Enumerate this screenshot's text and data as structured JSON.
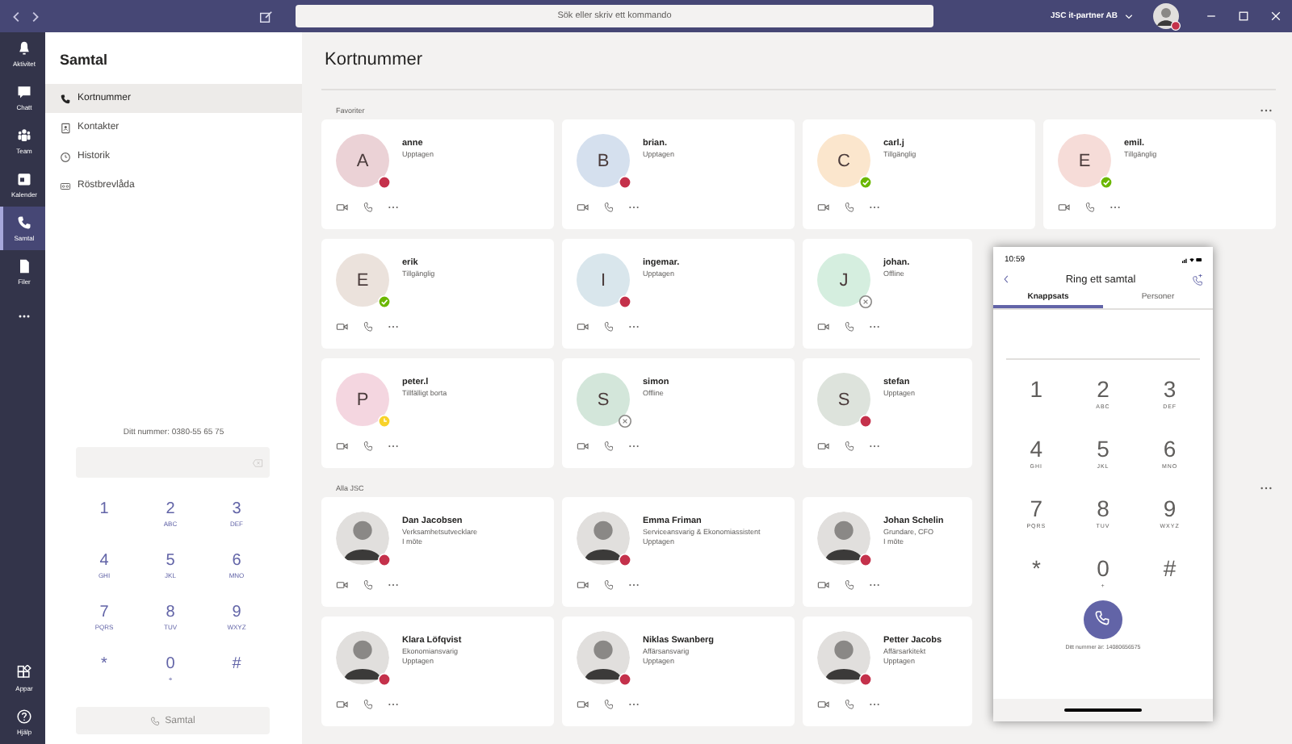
{
  "title_bar": {
    "search": {
      "placeholder": "Sök eller skriv ett kommando"
    },
    "org": "JSC it-partner AB",
    "user": {
      "presence": {
        "kind": "busy"
      }
    }
  },
  "rail": {
    "items": [
      {
        "label": "Aktivitet",
        "kind": "bell",
        "selected": false
      },
      {
        "label": "Chatt",
        "kind": "chat",
        "selected": false
      },
      {
        "label": "Team",
        "kind": "team",
        "selected": false
      },
      {
        "label": "Kalender",
        "kind": "calendar",
        "selected": false
      },
      {
        "label": "Samtal",
        "kind": "phone",
        "selected": true
      },
      {
        "label": "Filer",
        "kind": "file",
        "selected": false
      },
      {
        "kind": "more",
        "selected": false
      }
    ],
    "bottom_items": [
      {
        "label": "Appar",
        "kind": "apps"
      },
      {
        "label": "Hjälp",
        "kind": "help"
      }
    ]
  },
  "sidebar": {
    "title": "Samtal",
    "items": [
      {
        "label": "Kortnummer",
        "kind": "phone",
        "selected": true
      },
      {
        "label": "Kontakter",
        "kind": "contacts",
        "selected": false
      },
      {
        "label": "Historik",
        "kind": "clock",
        "selected": false
      },
      {
        "label": "Röstbrevlåda",
        "kind": "voicemail",
        "selected": false
      }
    ],
    "dialpad": {
      "your_number": "Ditt nummer: 0380-55 65 75",
      "keys": [
        {
          "digit": "1"
        },
        {
          "digit": "2",
          "letters": "ABC"
        },
        {
          "digit": "3",
          "letters": "DEF"
        },
        {
          "digit": "4",
          "letters": "GHI"
        },
        {
          "digit": "5",
          "letters": "JKL"
        },
        {
          "digit": "6",
          "letters": "MNO"
        },
        {
          "digit": "7",
          "letters": "PQRS"
        },
        {
          "digit": "8",
          "letters": "TUV"
        },
        {
          "digit": "9",
          "letters": "WXYZ"
        },
        {
          "digit": "*"
        },
        {
          "digit": "0",
          "letters": "+"
        },
        {
          "digit": "#"
        }
      ],
      "call_button": {
        "label": "Samtal",
        "disabled": true
      }
    }
  },
  "main": {
    "title": "Kortnummer",
    "sections": [
      {
        "label": "Favoriter",
        "contacts": [
          {
            "initial": "A",
            "color": "#ebd2d6",
            "name": "anne",
            "status": "Upptagen",
            "presence": {
              "kind": "busy"
            }
          },
          {
            "initial": "B",
            "color": "#d5e0ee",
            "name": "brian.",
            "status": "Upptagen",
            "presence": {
              "kind": "busy"
            }
          },
          {
            "initial": "C",
            "color": "#fbe6cd",
            "name": "carl.j",
            "status": "Tillgänglig",
            "presence": {
              "kind": "available"
            }
          },
          {
            "initial": "E",
            "color": "#f6dcd8",
            "name": "emil.",
            "status": "Tillgänglig",
            "presence": {
              "kind": "available"
            }
          },
          {
            "initial": "E",
            "color": "#ebe2dc",
            "name": "erik",
            "status": "Tillgänglig",
            "presence": {
              "kind": "available"
            }
          },
          {
            "initial": "I",
            "color": "#d9e6ec",
            "name": "ingemar.",
            "status": "Upptagen",
            "presence": {
              "kind": "busy"
            }
          },
          {
            "initial": "J",
            "color": "#d5eedf",
            "name": "johan.",
            "status": "Offline",
            "presence": {
              "kind": "offline"
            }
          },
          {
            "initial": "P",
            "color": "#f4d6e0",
            "name": "peter.l",
            "status": "Tillfälligt borta",
            "presence": {
              "kind": "away"
            }
          },
          {
            "initial": "S",
            "color": "#d3e6da",
            "name": "simon",
            "status": "Offline",
            "presence": {
              "kind": "offline"
            }
          },
          {
            "initial": "S",
            "color": "#dde3dc",
            "name": "stefan",
            "status": "Upptagen",
            "presence": {
              "kind": "busy"
            }
          }
        ]
      },
      {
        "label": "Alla JSC",
        "contacts": [
          {
            "name": "Dan Jacobsen",
            "role": "Verksamhetsutvecklare",
            "status": "I möte",
            "presence": {
              "kind": "busy"
            }
          },
          {
            "name": "Emma Friman",
            "role": "Serviceansvarig & Ekonomiassistent",
            "status": "Upptagen",
            "presence": {
              "kind": "busy"
            }
          },
          {
            "name": "Johan Schelin",
            "role": "Grundare, CFO",
            "status": "I möte",
            "presence": {
              "kind": "busy"
            }
          },
          {
            "name": "Klara Löfqvist",
            "role": "Ekonomiansvarig",
            "status": "Upptagen",
            "presence": {
              "kind": "busy"
            }
          },
          {
            "name": "Niklas Swanberg",
            "role": "Affärsansvarig",
            "status": "Upptagen",
            "presence": {
              "kind": "busy"
            }
          },
          {
            "name": "Petter Jacobs",
            "role": "Affärsarkitekt",
            "status": "Upptagen",
            "presence": {
              "kind": "busy"
            }
          }
        ]
      }
    ]
  },
  "phone": {
    "time": "10:59",
    "title": "Ring ett samtal",
    "tabs": [
      {
        "label": "Knappsats",
        "selected": true
      },
      {
        "label": "Personer",
        "selected": false
      }
    ],
    "keys": [
      {
        "digit": "1"
      },
      {
        "digit": "2",
        "letters": "ABC"
      },
      {
        "digit": "3",
        "letters": "DEF"
      },
      {
        "digit": "4",
        "letters": "GHI"
      },
      {
        "digit": "5",
        "letters": "JKL"
      },
      {
        "digit": "6",
        "letters": "MNO"
      },
      {
        "digit": "7",
        "letters": "PQRS"
      },
      {
        "digit": "8",
        "letters": "TUV"
      },
      {
        "digit": "9",
        "letters": "WXYZ"
      },
      {
        "digit": "*"
      },
      {
        "digit": "0",
        "letters": "+"
      },
      {
        "digit": "#"
      }
    ],
    "your_number": "Ditt nummer är: 14080656575"
  }
}
